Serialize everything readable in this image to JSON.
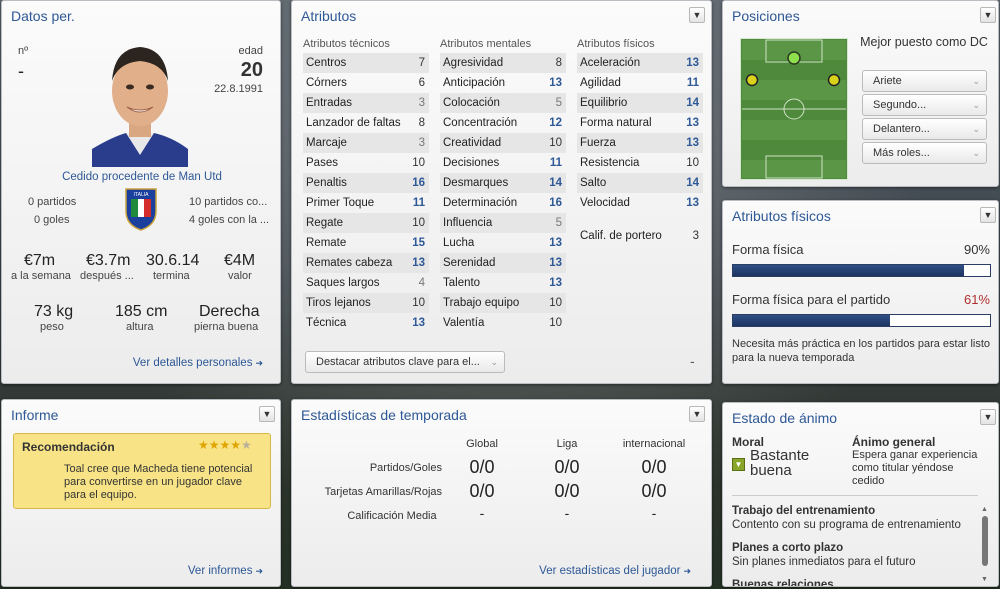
{
  "personal": {
    "title": "Datos per.",
    "num_label": "nº",
    "num_value": "-",
    "age_label": "edad",
    "age_value": "20",
    "birth": "22.8.1991",
    "loan_text": "Cedido procedente de Man Utd",
    "partidos": "0 partidos",
    "goles": "0 goles",
    "nat_partidos": "10 partidos co...",
    "nat_goles": "4 goles con la ...",
    "crest_text": "ITALIA",
    "wage": "€7m",
    "wage_label": "a la semana",
    "after": "€3.7m",
    "after_label": "después ...",
    "expiry": "30.6.14",
    "expiry_label": "termina",
    "value": "€4M",
    "value_label": "valor",
    "weight": "73 kg",
    "weight_label": "peso",
    "height": "185 cm",
    "height_label": "altura",
    "foot": "Derecha",
    "foot_label": "pierna buena",
    "link": "Ver detalles personales"
  },
  "attributes": {
    "title": "Atributos",
    "tech_header": "Atributos técnicos",
    "mental_header": "Atributos mentales",
    "phys_header": "Atributos físicos",
    "technical": [
      {
        "name": "Centros",
        "value": "7",
        "style": "dark"
      },
      {
        "name": "Córners",
        "value": "6",
        "style": "dark"
      },
      {
        "name": "Entradas",
        "value": "3",
        "style": "grey"
      },
      {
        "name": "Lanzador de faltas",
        "value": "8",
        "style": "dark"
      },
      {
        "name": "Marcaje",
        "value": "3",
        "style": "grey"
      },
      {
        "name": "Pases",
        "value": "10",
        "style": "dark"
      },
      {
        "name": "Penaltis",
        "value": "16",
        "style": "blue"
      },
      {
        "name": "Primer Toque",
        "value": "11",
        "style": "blue"
      },
      {
        "name": "Regate",
        "value": "10",
        "style": "dark"
      },
      {
        "name": "Remate",
        "value": "15",
        "style": "blue"
      },
      {
        "name": "Remates cabeza",
        "value": "13",
        "style": "blue"
      },
      {
        "name": "Saques largos",
        "value": "4",
        "style": "grey"
      },
      {
        "name": "Tiros lejanos",
        "value": "10",
        "style": "dark"
      },
      {
        "name": "Técnica",
        "value": "13",
        "style": "blue"
      }
    ],
    "mental": [
      {
        "name": "Agresividad",
        "value": "8",
        "style": "dark"
      },
      {
        "name": "Anticipación",
        "value": "13",
        "style": "blue"
      },
      {
        "name": "Colocación",
        "value": "5",
        "style": "grey"
      },
      {
        "name": "Concentración",
        "value": "12",
        "style": "blue"
      },
      {
        "name": "Creatividad",
        "value": "10",
        "style": "dark"
      },
      {
        "name": "Decisiones",
        "value": "11",
        "style": "blue"
      },
      {
        "name": "Desmarques",
        "value": "14",
        "style": "blue"
      },
      {
        "name": "Determinación",
        "value": "16",
        "style": "blue"
      },
      {
        "name": "Influencia",
        "value": "5",
        "style": "grey"
      },
      {
        "name": "Lucha",
        "value": "13",
        "style": "blue"
      },
      {
        "name": "Serenidad",
        "value": "13",
        "style": "blue"
      },
      {
        "name": "Talento",
        "value": "13",
        "style": "blue"
      },
      {
        "name": "Trabajo equipo",
        "value": "10",
        "style": "dark"
      },
      {
        "name": "Valentía",
        "value": "10",
        "style": "dark"
      }
    ],
    "physical": [
      {
        "name": "Aceleración",
        "value": "13",
        "style": "blue"
      },
      {
        "name": "Agilidad",
        "value": "11",
        "style": "blue"
      },
      {
        "name": "Equilibrio",
        "value": "14",
        "style": "blue"
      },
      {
        "name": "Forma natural",
        "value": "13",
        "style": "blue"
      },
      {
        "name": "Fuerza",
        "value": "13",
        "style": "blue"
      },
      {
        "name": "Resistencia",
        "value": "10",
        "style": "dark"
      },
      {
        "name": "Salto",
        "value": "14",
        "style": "blue"
      },
      {
        "name": "Velocidad",
        "value": "13",
        "style": "blue"
      }
    ],
    "gk_label": "Calif. de portero",
    "gk_value": "3",
    "highlight_btn": "Destacar atributos clave para el...",
    "dash": "-"
  },
  "positions": {
    "title": "Posiciones",
    "best_label": "Mejor puesto como DC",
    "roles": [
      "Ariete",
      "Segundo...",
      "Delantero...",
      "Más roles..."
    ]
  },
  "physical_panel": {
    "title": "Atributos físicos",
    "fitness_label": "Forma física",
    "fitness_value": "90%",
    "fitness_fraction": 0.9,
    "match_label": "Forma física para el partido",
    "match_value": "61%",
    "match_fraction": 0.61,
    "note": "Necesita más práctica en los partidos para estar listo para la nueva temporada",
    "match_color": "#b03030"
  },
  "report": {
    "title": "Informe",
    "rec_title": "Recomendación",
    "stars": "4.5 of 5",
    "rec_text": "Toal cree que Macheda tiene potencial para convertirse en un jugador clave para el equipo.",
    "link": "Ver informes"
  },
  "season": {
    "title": "Estadísticas de temporada",
    "cols": [
      "Global",
      "Liga",
      "internacional"
    ],
    "rows": [
      {
        "label": "Partidos/Goles",
        "values": [
          "0/0",
          "0/0",
          "0/0"
        ]
      },
      {
        "label": "Tarjetas Amarillas/Rojas",
        "values": [
          "0/0",
          "0/0",
          "0/0"
        ]
      },
      {
        "label": "Calificación Media",
        "values": [
          "-",
          "-",
          "-"
        ]
      }
    ],
    "link": "Ver estadísticas del jugador"
  },
  "morale": {
    "title": "Estado de ánimo",
    "moral_label": "Moral",
    "moral_value": "Bastante buena",
    "general_label": "Ánimo general",
    "general_text": "Espera ganar experiencia como titular yéndose cedido",
    "items": [
      {
        "head": "Trabajo del entrenamiento",
        "text": "Contento con su programa de entrenamiento"
      },
      {
        "head": "Planes a corto plazo",
        "text": "Sin planes inmediatos para el futuro"
      },
      {
        "head": "Buenas relaciones",
        "text": ""
      }
    ]
  },
  "colors": {
    "accent": "#2e5896",
    "star": "#e0a400",
    "note_bg": "#f8e486"
  }
}
